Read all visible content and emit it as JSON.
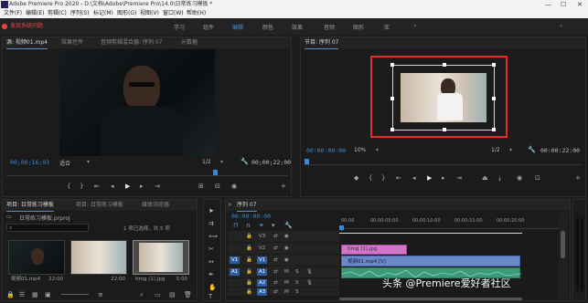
{
  "titlebar": {
    "title": "Adobe Premiere Pro 2020 - D:\\文档\\Adobe\\Premiere Pro\\14.0\\日常练习模板 *",
    "min": "—",
    "max": "☐",
    "close": "✕"
  },
  "menu": [
    "文件(F)",
    "编辑(E)",
    "剪辑(C)",
    "序列(S)",
    "标记(M)",
    "图形(G)",
    "视图(V)",
    "窗口(W)",
    "帮助(H)"
  ],
  "warning": "发现系统问题",
  "workspaces": [
    "学习",
    "组件",
    "编辑",
    "颜色",
    "效果",
    "音频",
    "图形",
    "库"
  ],
  "active_workspace": "编辑",
  "source_panel": {
    "tabs": [
      "源: 视频01.mp4",
      "效果控件",
      "音频剪辑混合器: 序列 07",
      "元数据"
    ],
    "timecode_left": "00;00;16;03",
    "fit": "适合",
    "scale": "1/2",
    "timecode_right": "00;00;22;00"
  },
  "program_panel": {
    "tab": "节目: 序列 07",
    "timecode_left": "00:00:00:00",
    "zoom": "10%",
    "scale": "1/2",
    "timecode_right": "00:00:22:00"
  },
  "project_panel": {
    "tabs": [
      "项目: 日常练习模板",
      "项目: 日常练习模板",
      "媒体浏览器"
    ],
    "filename": "日常练习模板.prproj",
    "selection": "1 项已选择，共 5 项",
    "items": [
      {
        "name": "视频01.mp4",
        "duration": "22:00"
      },
      {
        "name": "",
        "duration": "22:00"
      },
      {
        "name": "timg (1).jpg",
        "duration": "5:00"
      }
    ]
  },
  "sequence_panel": {
    "tab": "序列 07",
    "timecode": "00:00:00:00",
    "ruler": [
      "00:00",
      "00:00:05:00",
      "00:00:10:00",
      "00:00:15:00",
      "00:00:20:00"
    ],
    "video_tracks": [
      "V3",
      "V2",
      "V1"
    ],
    "audio_tracks": [
      "A1",
      "A2",
      "A3"
    ],
    "source_patch": [
      "V1",
      "A1"
    ],
    "clips": [
      {
        "name": "timg (1).jpg",
        "track": "V2"
      },
      {
        "name": "视频01.mp4 [V]",
        "track": "V1"
      }
    ]
  },
  "watermark": "头条 @Premiere爱好者社区"
}
